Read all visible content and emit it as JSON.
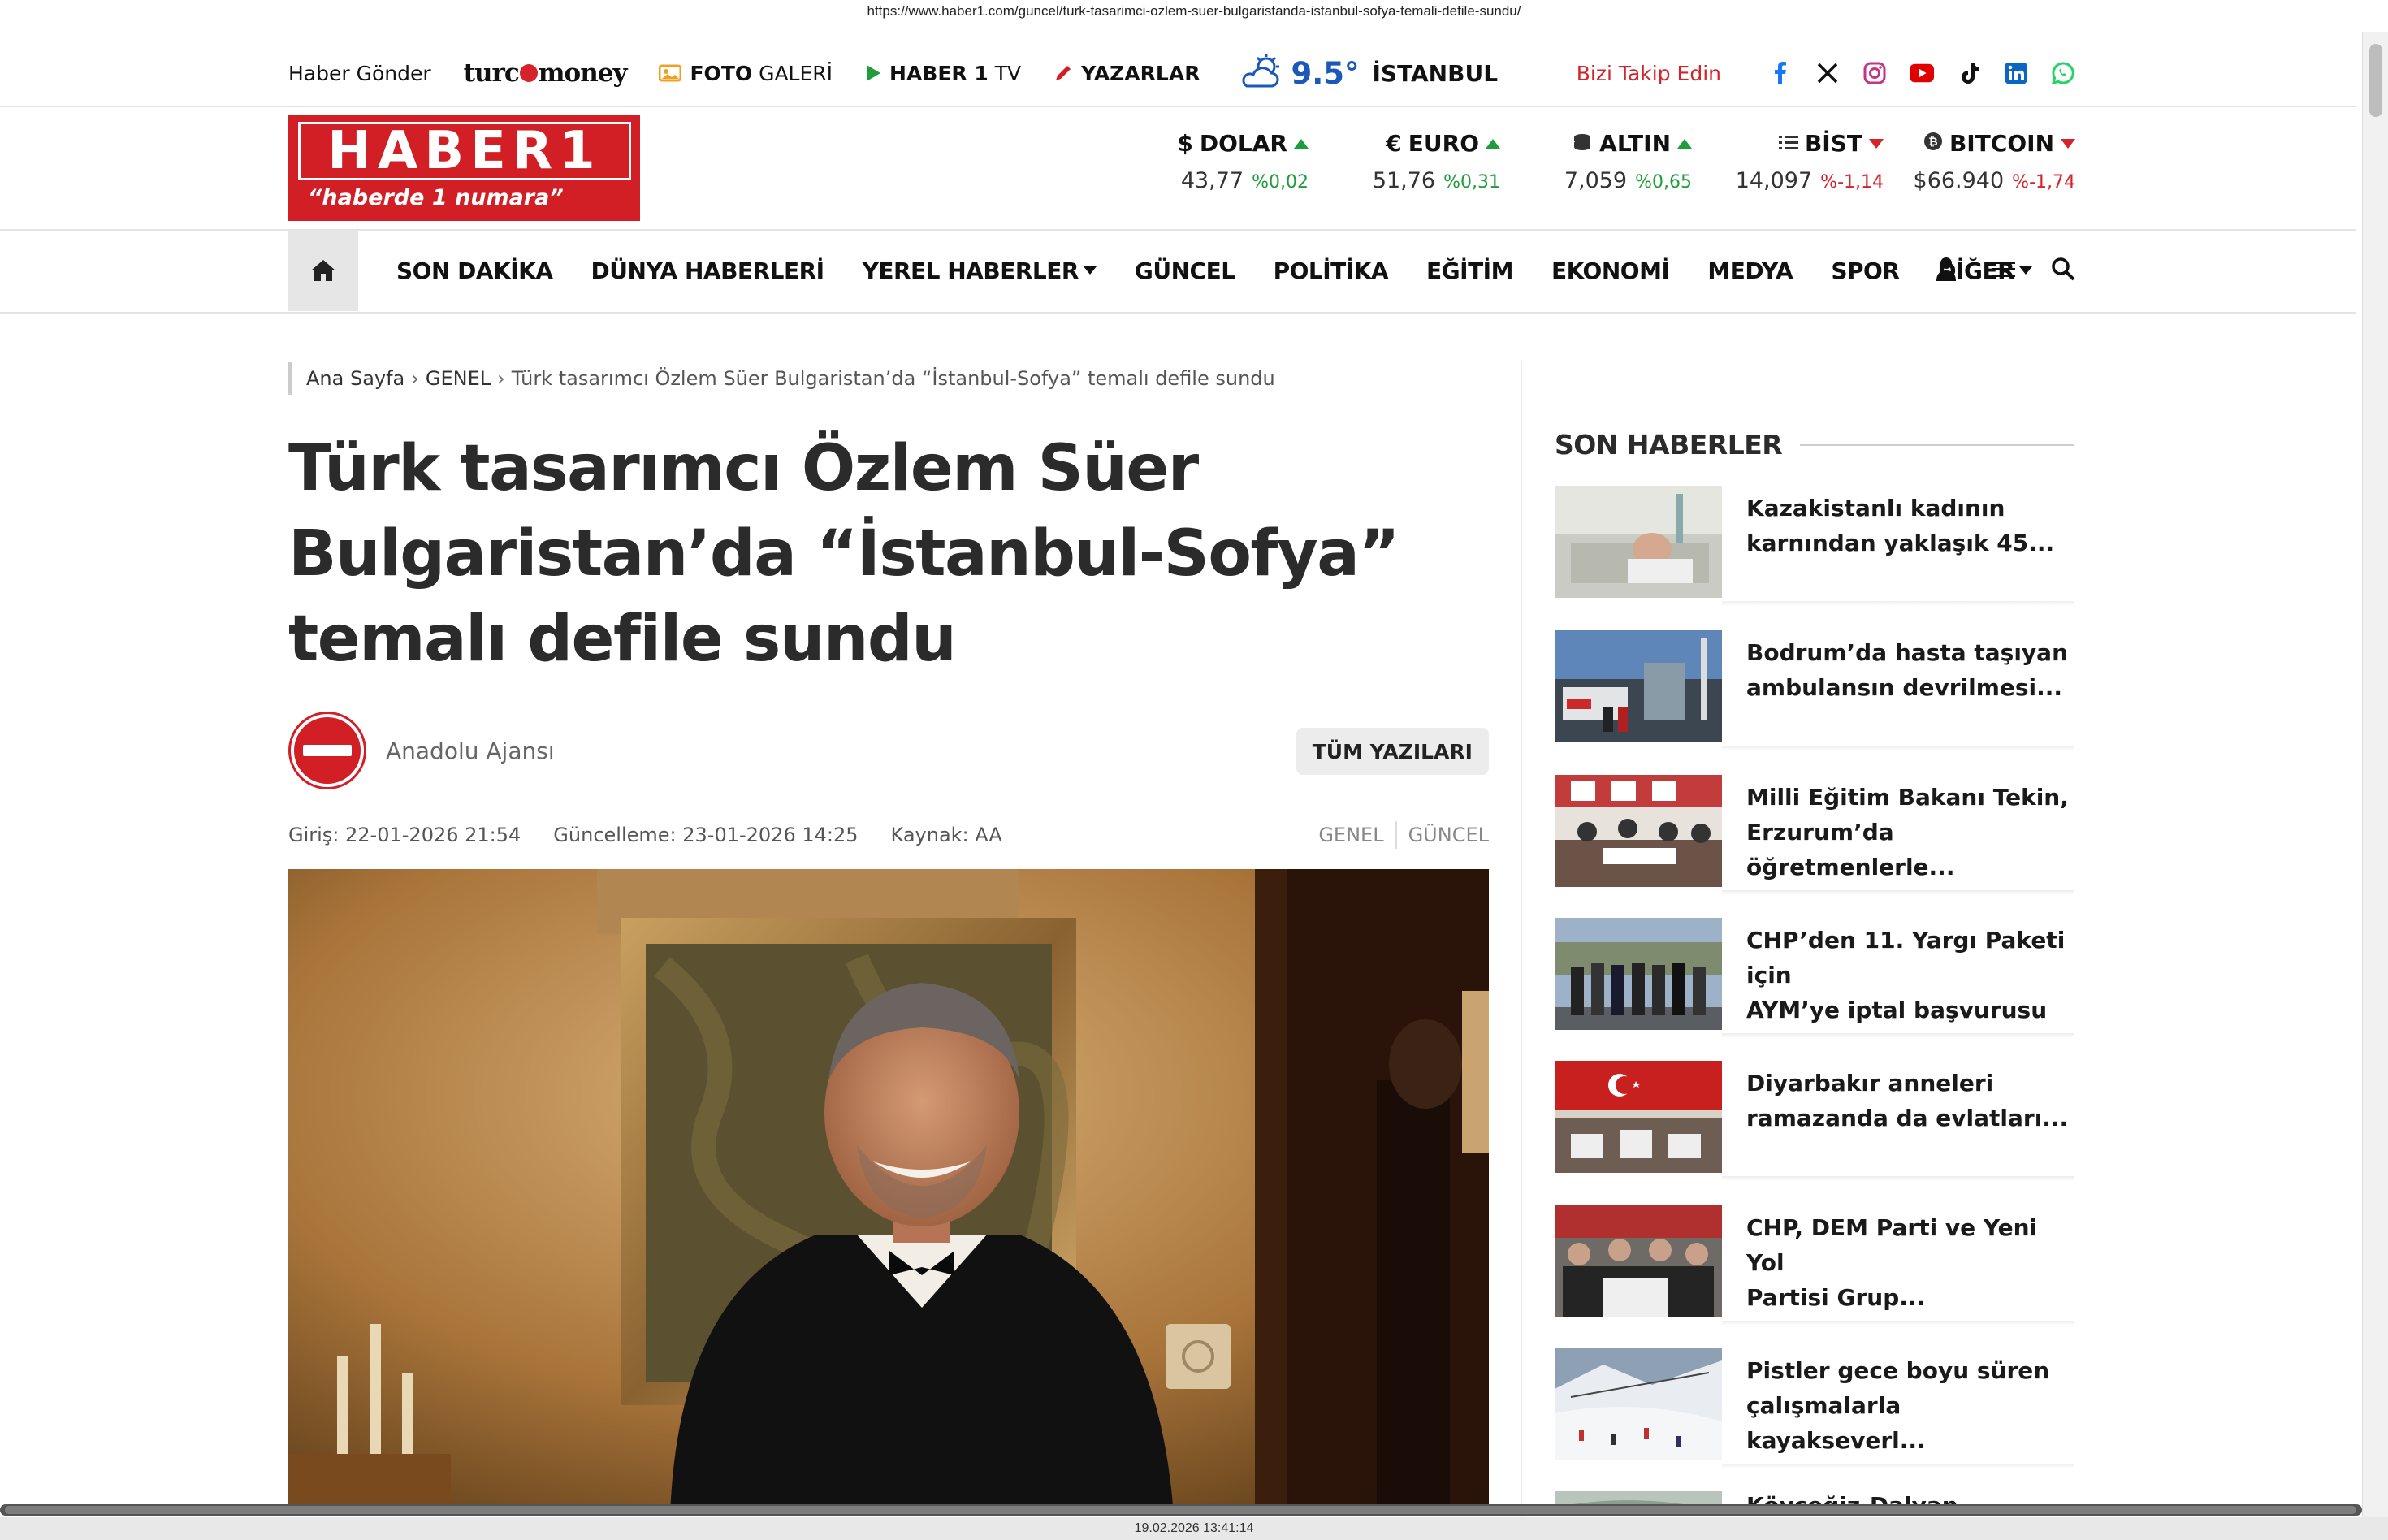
{
  "browser": {
    "url": "https://www.haber1.com/guncel/turk-tasarimci-ozlem-suer-bulgaristanda-istanbul-sofya-temali-defile-sundu/",
    "timestamp": "19.02.2026 13:41:14"
  },
  "topbar": {
    "haber_gonder": "Haber Gönder",
    "turco_left": "turc",
    "turco_right": "money",
    "foto_bold": "FOTO",
    "foto_rest": "GALERİ",
    "tv_bold": "HABER 1",
    "tv_rest": "TV",
    "yazarlar": "YAZARLAR",
    "weather_temp": "9.5°",
    "weather_city": "İSTANBUL",
    "follow_label": "Bizi Takip Edin",
    "social_icons": [
      "facebook-icon",
      "x-icon",
      "instagram-icon",
      "youtube-icon",
      "tiktok-icon",
      "linkedin-icon",
      "whatsapp-icon"
    ]
  },
  "logo": {
    "text": "HABER1",
    "tagline": "“haberde 1 numara”",
    "color": "#d21e25"
  },
  "finance": [
    {
      "symbol": "$",
      "name": "DOLAR",
      "value": "43,77",
      "change": "%0,02",
      "trend": "up"
    },
    {
      "symbol": "€",
      "name": "EURO",
      "value": "51,76",
      "change": "%0,31",
      "trend": "up"
    },
    {
      "symbol": "coins",
      "name": "ALTIN",
      "value": "7,059",
      "change": "%0,65",
      "trend": "up"
    },
    {
      "symbol": "list",
      "name": "BİST",
      "value": "14,097",
      "change": "%-1,14",
      "trend": "down"
    },
    {
      "symbol": "bitcoin",
      "name": "BITCOIN",
      "value": "$66.940",
      "change": "%-1,74",
      "trend": "down"
    }
  ],
  "nav": {
    "items": [
      {
        "label": "SON DAKİKA",
        "dropdown": false
      },
      {
        "label": "DÜNYA HABERLERİ",
        "dropdown": false
      },
      {
        "label": "YEREL HABERLER",
        "dropdown": true
      },
      {
        "label": "GÜNCEL",
        "dropdown": false
      },
      {
        "label": "POLİTİKA",
        "dropdown": false
      },
      {
        "label": "EĞİTİM",
        "dropdown": false
      },
      {
        "label": "EKONOMİ",
        "dropdown": false
      },
      {
        "label": "MEDYA",
        "dropdown": false
      },
      {
        "label": "SPOR",
        "dropdown": false
      },
      {
        "label": "DİĞER",
        "dropdown": true
      }
    ]
  },
  "article": {
    "breadcrumb": {
      "home": "Ana Sayfa",
      "sep": "›",
      "category": "GENEL",
      "current": "Türk tasarımcı Özlem Süer Bulgaristan’da “İstanbul-Sofya” temalı defile sundu"
    },
    "title_lines": [
      "Türk tasarımcı Özlem Süer",
      "Bulgaristan’da “İstanbul-Sofya”",
      "temalı defile sundu"
    ],
    "author": "Anadolu Ajansı",
    "all_posts": "TÜM YAZILARI",
    "published": "Giriş: 22-01-2026 21:54",
    "updated": "Güncelleme: 23-01-2026 14:25",
    "source": "Kaynak: AA",
    "tags": [
      "GENEL",
      "GÜNCEL"
    ]
  },
  "sidebar": {
    "heading": "SON HABERLER",
    "items": [
      {
        "line1": "Kazakistanlı kadının",
        "line2": "karnından yaklaşık 45..."
      },
      {
        "line1": "Bodrum’da hasta taşıyan",
        "line2": "ambulansın devrilmesi..."
      },
      {
        "line1": "Milli Eğitim Bakanı Tekin,",
        "line2": "Erzurum’da öğretmenlerle..."
      },
      {
        "line1": "CHP’den 11. Yargı Paketi için",
        "line2": "AYM’ye iptal başvurusu"
      },
      {
        "line1": "Diyarbakır anneleri",
        "line2": "ramazanda da evlatları..."
      },
      {
        "line1": "CHP, DEM Parti ve Yeni Yol",
        "line2": "Partisi Grup..."
      },
      {
        "line1": "Pistler gece boyu süren",
        "line2": "çalışmalarla kayakseverl..."
      },
      {
        "line1": "Köyceğiz-Dalyan hattında",
        "line2": ""
      }
    ]
  }
}
